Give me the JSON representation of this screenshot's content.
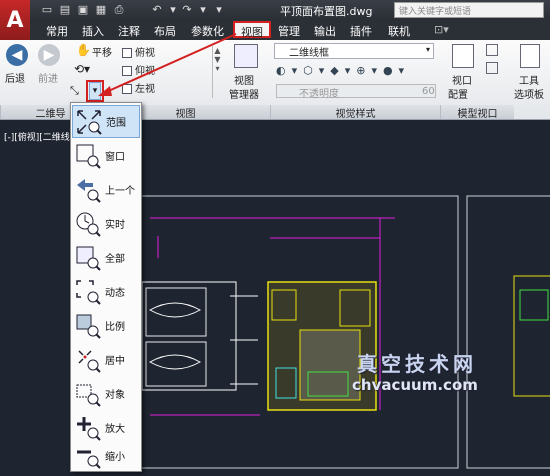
{
  "app": {
    "logo": "A",
    "doc_title": "平顶面布置图.dwg",
    "search_placeholder": "键入关键字或短语"
  },
  "tabs": [
    {
      "label": "常用"
    },
    {
      "label": "插入"
    },
    {
      "label": "注释"
    },
    {
      "label": "布局"
    },
    {
      "label": "参数化"
    },
    {
      "label": "视图",
      "active": true
    },
    {
      "label": "管理"
    },
    {
      "label": "输出"
    },
    {
      "label": "插件"
    },
    {
      "label": "联机"
    }
  ],
  "ribbon": {
    "back_label": "后退",
    "forward_label": "前进",
    "pan_label": "平移",
    "nav_panel_label": "二维导",
    "view_items": [
      "俯视",
      "仰视",
      "左视"
    ],
    "view_manager_label_1": "视图",
    "view_manager_label_2": "管理器",
    "views_panel_label": "视图",
    "visual_style_value": "二维线框",
    "opacity_label": "不透明度",
    "opacity_value": "60",
    "visual_styles_panel_label": "视觉样式",
    "viewport_config_label_1": "视口",
    "viewport_config_label_2": "配置",
    "model_viewport_panel_label": "模型视口",
    "tools_label_1": "工具",
    "tools_label_2": "选项板"
  },
  "viewport_label": "[-][俯视][二维线",
  "zoom_menu": [
    {
      "label": "范围",
      "icon": "zoom-extents-icon",
      "highlighted": true
    },
    {
      "label": "窗口",
      "icon": "zoom-window-icon"
    },
    {
      "label": "上一个",
      "icon": "zoom-previous-icon"
    },
    {
      "label": "实时",
      "icon": "zoom-realtime-icon"
    },
    {
      "label": "全部",
      "icon": "zoom-all-icon"
    },
    {
      "label": "动态",
      "icon": "zoom-dynamic-icon"
    },
    {
      "label": "比例",
      "icon": "zoom-scale-icon"
    },
    {
      "label": "居中",
      "icon": "zoom-center-icon"
    },
    {
      "label": "对象",
      "icon": "zoom-object-icon"
    },
    {
      "label": "放大",
      "icon": "zoom-in-icon"
    },
    {
      "label": "缩小",
      "icon": "zoom-out-icon"
    }
  ],
  "watermark": {
    "line1": "真空技术网",
    "line2": "chvacuum.com"
  },
  "colors": {
    "accent_red": "#d32020",
    "canvas_bg": "#1e2430",
    "drawing_yellow": "#e8e010",
    "drawing_magenta": "#e020e0"
  }
}
